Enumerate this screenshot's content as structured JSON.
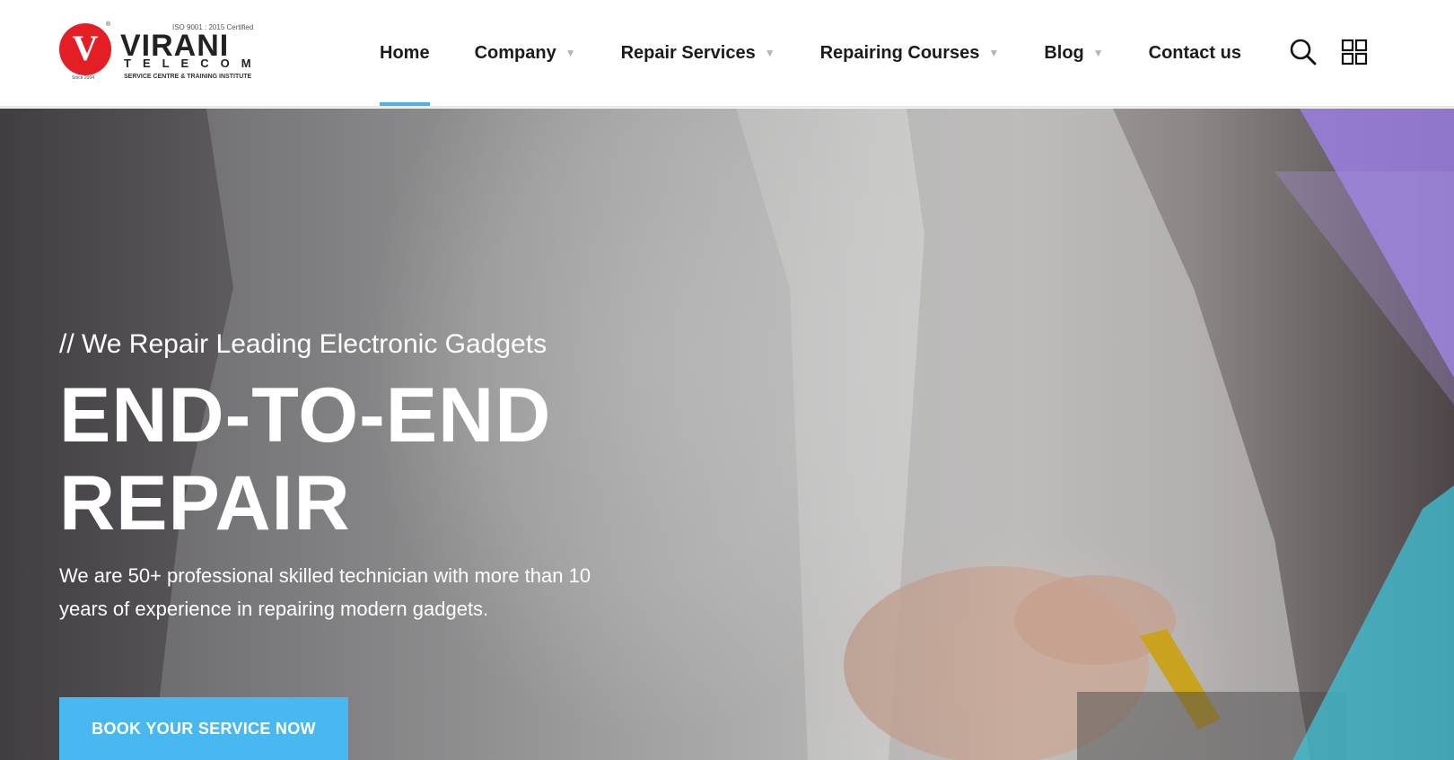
{
  "brand": {
    "logo_letter": "V",
    "name": "VIRANI",
    "sub_name": "TELECOM",
    "certification": "ISO 9001 : 2015 Certified",
    "tagline": "SERVICE CENTRE & TRAINING INSTITUTE",
    "since": "Since 2004",
    "registered": "®"
  },
  "nav": {
    "items": [
      {
        "label": "Home",
        "dropdown": false,
        "active": true
      },
      {
        "label": "Company",
        "dropdown": true
      },
      {
        "label": "Repair Services",
        "dropdown": true
      },
      {
        "label": "Repairing Courses",
        "dropdown": true
      },
      {
        "label": "Blog",
        "dropdown": true
      },
      {
        "label": "Contact us",
        "dropdown": false
      }
    ],
    "caret_glyph": "▼",
    "icons": [
      "search-icon",
      "grid-menu-icon"
    ]
  },
  "hero": {
    "subtitle": "// We Repair Leading Electronic Gadgets",
    "title_line1": "END-TO-END",
    "title_line2": "REPAIR",
    "description": "We are 50+ professional skilled technician with more than 10 years of experience in repairing modern gadgets.",
    "cta_label": "BOOK YOUR SERVICE NOW"
  },
  "colors": {
    "accent": "#4ab8f0",
    "brand_red": "#e31e24",
    "nav_text": "#1b1b1b",
    "purple_shape": "#9b7fe0",
    "teal_shape": "#3fc3d6"
  }
}
